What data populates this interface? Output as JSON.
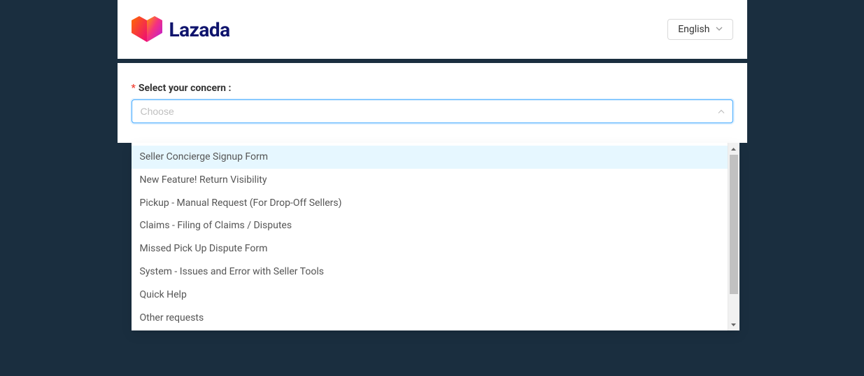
{
  "header": {
    "brand": "Lazada",
    "language": "English"
  },
  "form": {
    "label": "Select your concern :",
    "placeholder": "Choose",
    "options": [
      "Seller Concierge Signup Form",
      "New Feature! Return Visibility",
      "Pickup - Manual Request (For Drop-Off Sellers)",
      "Claims - Filing of Claims / Disputes",
      "Missed Pick Up Dispute Form",
      "System - Issues and Error with Seller Tools",
      "Quick Help",
      "Other requests"
    ]
  }
}
